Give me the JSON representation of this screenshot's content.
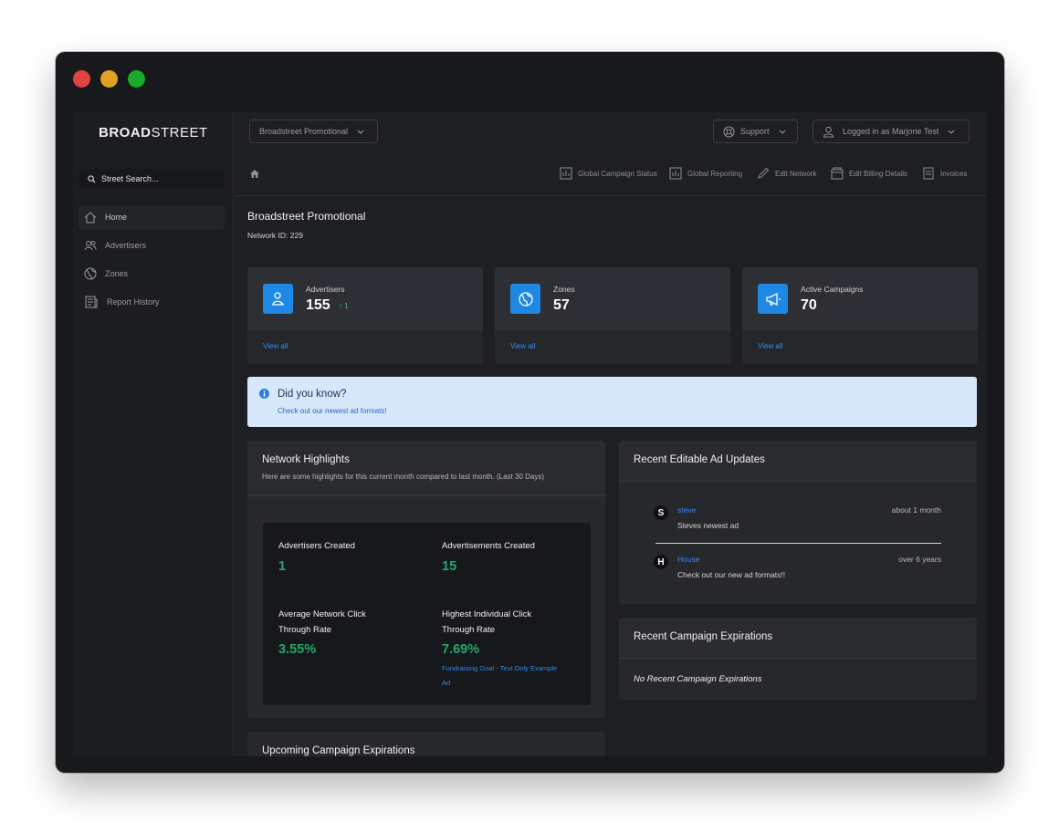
{
  "brand": {
    "bold": "BROAD",
    "rest": "STREET"
  },
  "search": {
    "placeholder": "Street Search..."
  },
  "sidebar": {
    "items": [
      {
        "label": "Home",
        "icon": "home-icon",
        "active": true
      },
      {
        "label": "Advertisers",
        "icon": "users-icon"
      },
      {
        "label": "Zones",
        "icon": "globe-icon"
      },
      {
        "label": "Report History",
        "icon": "report-icon"
      }
    ]
  },
  "topbar": {
    "network_select": "Broadstreet Promotional",
    "support": "Support",
    "user": "Logged in as Marjorie Test"
  },
  "quicklinks": [
    {
      "label": "Global Campaign Status",
      "icon": "chart-icon"
    },
    {
      "label": "Global Reporting",
      "icon": "chart-icon"
    },
    {
      "label": "Edit Network",
      "icon": "pencil-icon"
    },
    {
      "label": "Edit Billing Details",
      "icon": "wallet-icon"
    },
    {
      "label": "Invoices",
      "icon": "invoice-icon"
    }
  ],
  "page": {
    "title": "Broadstreet Promotional",
    "network_id": "Network ID: 229"
  },
  "stats": [
    {
      "label": "Advertisers",
      "value": "155",
      "delta": "↑ 1",
      "view": "View all",
      "icon": "advertiser-icon"
    },
    {
      "label": "Zones",
      "value": "57",
      "view": "View all",
      "icon": "globe-icon"
    },
    {
      "label": "Active Campaigns",
      "value": "70",
      "view": "View all",
      "icon": "megaphone-icon"
    }
  ],
  "tip": {
    "heading": "Did you know?",
    "link": "Check out our newest ad formats!"
  },
  "highlights": {
    "title": "Network Highlights",
    "subtitle": "Here are some highlights for this current month compared to last month. (Last 30 Days)",
    "advertisers_created_label": "Advertisers Created",
    "advertisers_created": "1",
    "ads_created_label": "Advertisements Created",
    "ads_created": "15",
    "avg_ctr_label_1": "Average Network Click",
    "avg_ctr_label_2": "Through Rate",
    "avg_ctr": "3.55%",
    "top_ctr_label_1": "Highest Individual Click",
    "top_ctr_label_2": "Through Rate",
    "top_ctr": "7.69%",
    "top_ad_1": "Fundraising Goal - Text Only Example",
    "top_ad_2": "Ad"
  },
  "updates": {
    "title": "Recent Editable Ad Updates",
    "items": [
      {
        "initial": "S",
        "name": "steve",
        "time": "about 1 month",
        "text": "Steves newest ad"
      },
      {
        "initial": "H",
        "name": "House",
        "time": "over 6 years",
        "text": "Check out our new ad formats!!"
      }
    ]
  },
  "expirations": {
    "title": "Recent Campaign Expirations",
    "empty": "No Recent Campaign Expirations"
  },
  "upcoming": {
    "title": "Upcoming Campaign Expirations"
  }
}
